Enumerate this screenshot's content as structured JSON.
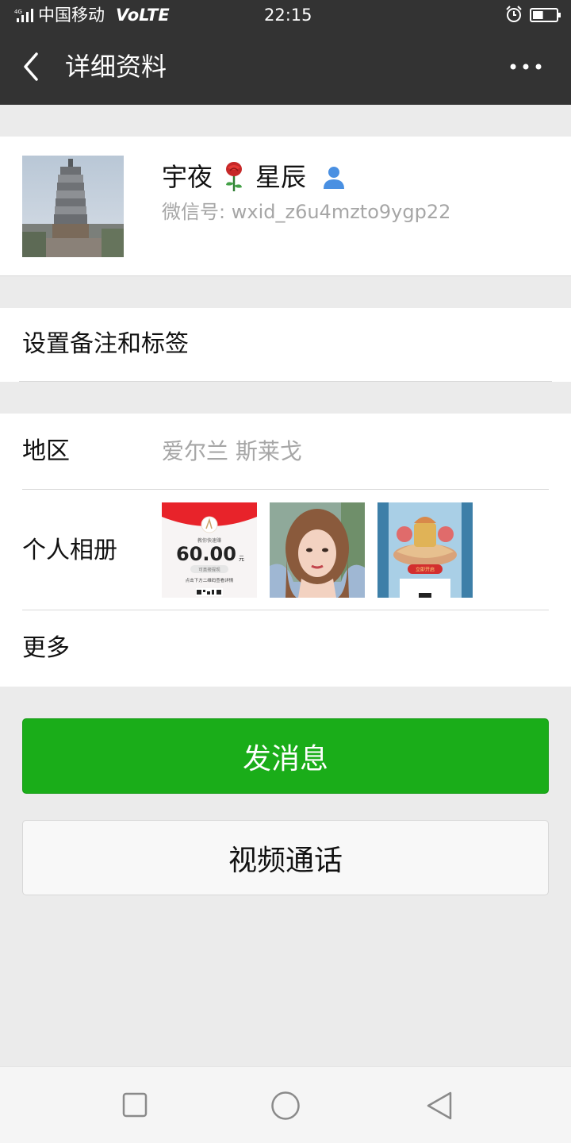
{
  "status_bar": {
    "network": "4G",
    "carrier": "中国移动",
    "volte": "VoLTE",
    "time": "22:15",
    "battery_level": 0.45
  },
  "header": {
    "title": "详细资料"
  },
  "profile": {
    "name_part1": "宇夜",
    "name_part2": "星辰",
    "emoji_icon": "rose-icon",
    "wechat_id_label": "微信号:",
    "wechat_id": "wxid_z6u4mzto9ygp22"
  },
  "remark": {
    "label": "设置备注和标签"
  },
  "info": {
    "region_label": "地区",
    "region_value": "爱尔兰  斯莱戈",
    "album_label": "个人相册",
    "more_label": "更多"
  },
  "album_thumbs": {
    "thumb1_amount": "60.00",
    "thumb1_unit": "元",
    "thumb1_subtitle": "教你快速赚",
    "thumb1_button": "可直接提现",
    "thumb1_caption": "点击下方二维码查看详情",
    "thumb3_button": "立即开启"
  },
  "buttons": {
    "send_message": "发消息",
    "video_call": "视频通话"
  },
  "colors": {
    "header_bg": "#333333",
    "primary_green": "#1aad19",
    "page_bg": "#ebebeb",
    "secondary_text": "#a6a6a6"
  }
}
